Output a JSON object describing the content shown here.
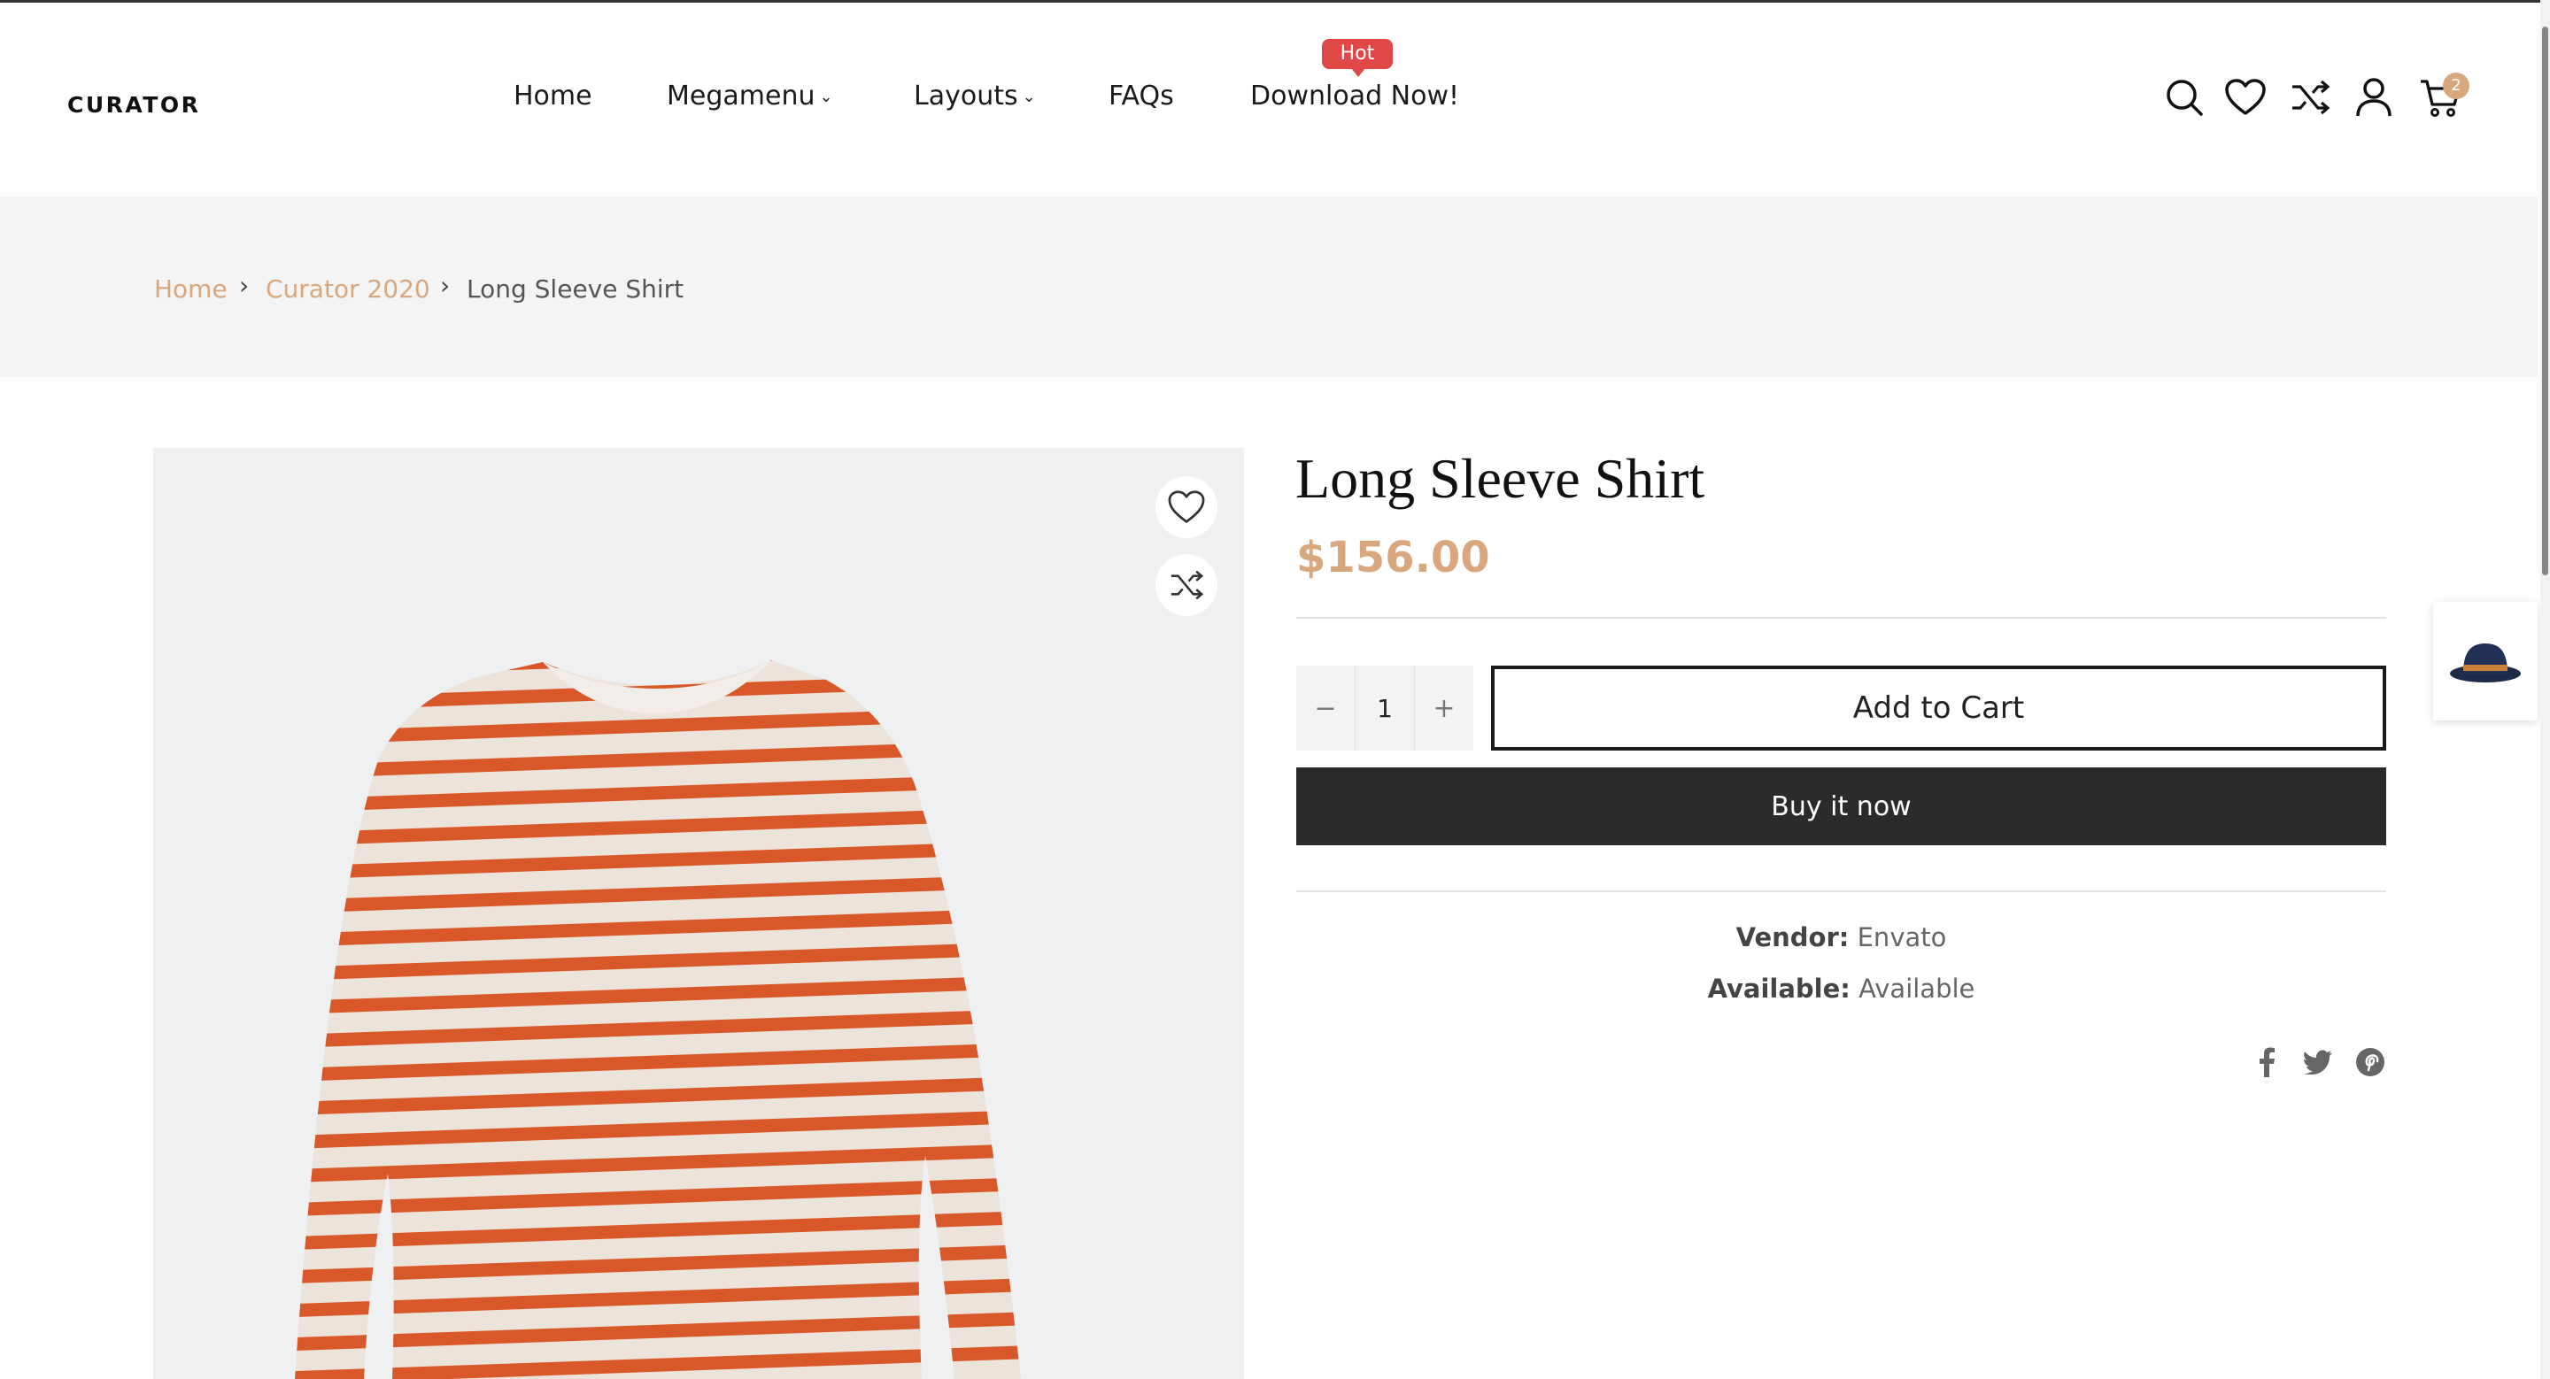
{
  "header": {
    "logo": "CURATOR",
    "nav": [
      {
        "label": "Home"
      },
      {
        "label": "Megamenu",
        "chevron": "⌄"
      },
      {
        "label": "Layouts",
        "chevron": "⌄"
      },
      {
        "label": "FAQs"
      },
      {
        "label": "Download Now!",
        "badge": "Hot"
      }
    ],
    "icons": [
      "search-icon",
      "heart-icon",
      "shuffle-icon",
      "user-icon",
      "cart-icon"
    ],
    "cart_count": "2"
  },
  "breadcrumb": {
    "items": [
      {
        "label": "Home"
      },
      {
        "label": "Curator 2020"
      },
      {
        "label": "Long Sleeve Shirt"
      }
    ],
    "separator": "›"
  },
  "product": {
    "title": "Long Sleeve Shirt",
    "price": "$156.00",
    "quantity": "1",
    "minus": "−",
    "plus": "+",
    "add_to_cart": "Add to Cart",
    "buy_now": "Buy it now",
    "vendor_label": "Vendor:",
    "vendor_value": "Envato",
    "available_label": "Available:",
    "available_value": "Available",
    "share_icons": [
      "facebook-icon",
      "twitter-icon",
      "pinterest-icon"
    ]
  },
  "colors": {
    "accent": "#d9a77d",
    "hot_badge": "#e04848",
    "dark_button": "#2b2b2b",
    "stripe": "#d9582a"
  }
}
